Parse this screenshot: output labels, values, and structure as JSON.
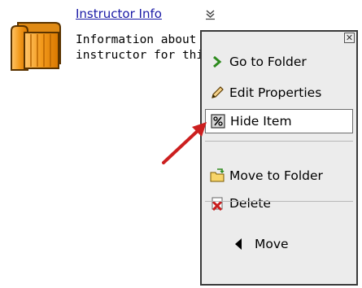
{
  "item": {
    "title": "Instructor Info",
    "description_line1": "Information about the",
    "description_line2": "instructor for this course"
  },
  "menu": {
    "close_glyph": "✕",
    "items": [
      {
        "label": "Go to Folder",
        "icon": "green-chevron-right-icon"
      },
      {
        "label": "Edit Properties",
        "icon": "pencil-icon"
      },
      {
        "label": "Hide Item",
        "icon": "hide-percent-icon"
      },
      {
        "label": "Move to Folder",
        "icon": "folder-move-icon"
      },
      {
        "label": "Delete",
        "icon": "delete-x-icon"
      }
    ],
    "move_label": "Move",
    "hovered_item": "Hide Item"
  },
  "colors": {
    "link": "#1a1aa6",
    "menu_bg": "#ececec",
    "arrow": "#cc1f1f",
    "folder": "#f39a1c"
  }
}
